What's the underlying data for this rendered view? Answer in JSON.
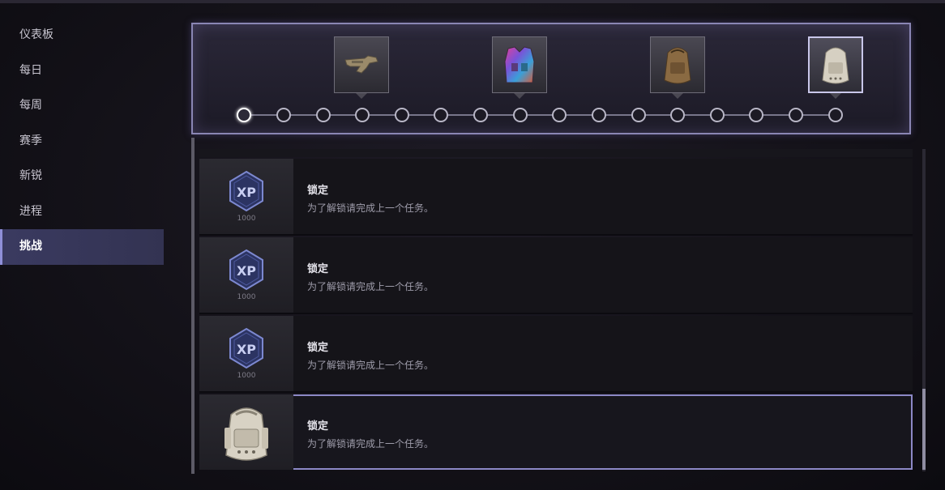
{
  "sidebar": {
    "items": [
      {
        "label": "仪表板"
      },
      {
        "label": "每日"
      },
      {
        "label": "每周"
      },
      {
        "label": "赛季"
      },
      {
        "label": "新锐"
      },
      {
        "label": "进程"
      },
      {
        "label": "挑战"
      }
    ],
    "active_index": 6
  },
  "track": {
    "node_count": 16,
    "current_node": 0,
    "rewards": [
      {
        "icon": "weapon-icon"
      },
      {
        "icon": "vest-icon"
      },
      {
        "icon": "backpack-brown-icon"
      },
      {
        "icon": "backpack-white-icon"
      }
    ]
  },
  "challenges": [
    {
      "title": "锁定",
      "desc": "为了解锁请完成上一个任务。",
      "reward_icon": "xp-badge-icon",
      "reward_amount": "1000"
    },
    {
      "title": "锁定",
      "desc": "为了解锁请完成上一个任务。",
      "reward_icon": "xp-badge-icon",
      "reward_amount": "1000"
    },
    {
      "title": "锁定",
      "desc": "为了解锁请完成上一个任务。",
      "reward_icon": "xp-badge-icon",
      "reward_amount": "1000"
    },
    {
      "title": "锁定",
      "desc": "为了解锁请完成上一个任务。",
      "reward_icon": "backpack-white-icon",
      "reward_amount": ""
    }
  ],
  "colors": {
    "accent": "#8c88c6",
    "active_tab": "#3a3a60"
  }
}
